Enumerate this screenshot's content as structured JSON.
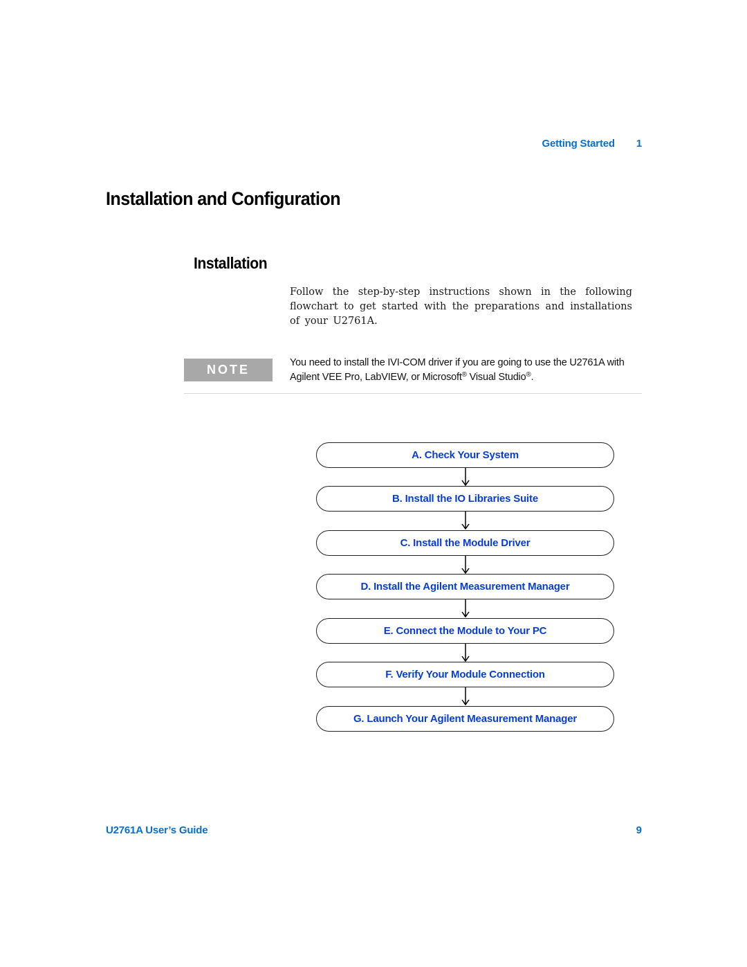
{
  "header": {
    "section": "Getting Started",
    "chapter_number": "1"
  },
  "headings": {
    "title": "Installation and Configuration",
    "subtitle": "Installation"
  },
  "body": {
    "intro": "Follow the step-by-step instructions shown in the following flowchart to get started with the preparations and installations of your U2761A."
  },
  "note": {
    "label": "NOTE",
    "text_part1": "You need to install the IVI-COM driver if you are going to use the U2761A with Agilent VEE Pro, LabVIEW, or Microsoft",
    "registered_mark": "®",
    "text_part2": " Visual Studio",
    "text_part3": "."
  },
  "flowchart": {
    "steps": [
      {
        "label": "A. Check Your System"
      },
      {
        "label": "B. Install the IO Libraries Suite"
      },
      {
        "label": "C. Install the Module Driver"
      },
      {
        "label": "D. Install the Agilent Measurement Manager"
      },
      {
        "label": "E. Connect the Module to Your PC"
      },
      {
        "label": "F. Verify Your Module Connection"
      },
      {
        "label": "G. Launch Your Agilent Measurement Manager"
      }
    ],
    "arrow_icon": "down-arrow-icon"
  },
  "footer": {
    "title": "U2761A User’s Guide",
    "page_number": "9"
  },
  "colors": {
    "header_blue": "#0a6fc2",
    "flow_text_blue": "#0a3fc2",
    "note_gray": "#a8a8a8"
  }
}
